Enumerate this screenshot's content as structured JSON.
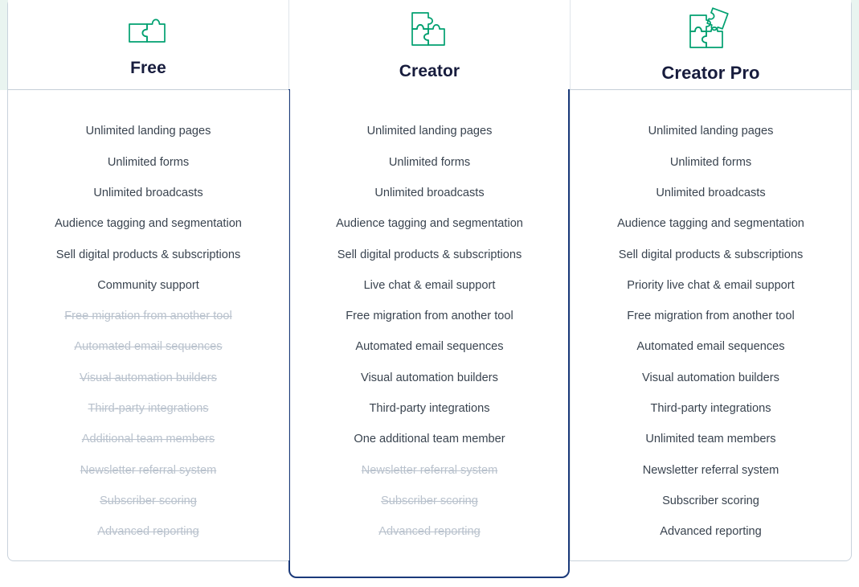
{
  "theme": {
    "accent_green": "#00a070",
    "heading_navy": "#171c3d",
    "body_text": "#39434f",
    "disabled_text": "#b9c2cd",
    "featured_border": "#1b3a7a",
    "divider": "#c5ced8",
    "mint_band": "#e9f4f0"
  },
  "plans": [
    {
      "name": "Free",
      "icon": "puzzle-2-piece-icon",
      "featured": false,
      "features": [
        {
          "label": "Unlimited landing pages",
          "included": true
        },
        {
          "label": "Unlimited forms",
          "included": true
        },
        {
          "label": "Unlimited broadcasts",
          "included": true
        },
        {
          "label": "Audience tagging and segmentation",
          "included": true
        },
        {
          "label": "Sell digital products & subscriptions",
          "included": true
        },
        {
          "label": "Community support",
          "included": true
        },
        {
          "label": "Free migration from another tool",
          "included": false
        },
        {
          "label": "Automated email sequences",
          "included": false
        },
        {
          "label": "Visual automation builders",
          "included": false
        },
        {
          "label": "Third-party integrations",
          "included": false
        },
        {
          "label": "Additional team members",
          "included": false
        },
        {
          "label": "Newsletter referral system",
          "included": false
        },
        {
          "label": "Subscriber scoring",
          "included": false
        },
        {
          "label": "Advanced reporting",
          "included": false
        }
      ]
    },
    {
      "name": "Creator",
      "icon": "puzzle-3-piece-icon",
      "featured": true,
      "features": [
        {
          "label": "Unlimited landing pages",
          "included": true
        },
        {
          "label": "Unlimited forms",
          "included": true
        },
        {
          "label": "Unlimited broadcasts",
          "included": true
        },
        {
          "label": "Audience tagging and segmentation",
          "included": true
        },
        {
          "label": "Sell digital products & subscriptions",
          "included": true
        },
        {
          "label": "Live chat & email support",
          "included": true
        },
        {
          "label": "Free migration from another tool",
          "included": true
        },
        {
          "label": "Automated email sequences",
          "included": true
        },
        {
          "label": "Visual automation builders",
          "included": true
        },
        {
          "label": "Third-party integrations",
          "included": true
        },
        {
          "label": "One additional team member",
          "included": true
        },
        {
          "label": "Newsletter referral system",
          "included": false
        },
        {
          "label": "Subscriber scoring",
          "included": false
        },
        {
          "label": "Advanced reporting",
          "included": false
        }
      ]
    },
    {
      "name": "Creator Pro",
      "icon": "puzzle-4-piece-icon",
      "featured": false,
      "features": [
        {
          "label": "Unlimited landing pages",
          "included": true
        },
        {
          "label": "Unlimited forms",
          "included": true
        },
        {
          "label": "Unlimited broadcasts",
          "included": true
        },
        {
          "label": "Audience tagging and segmentation",
          "included": true
        },
        {
          "label": "Sell digital products & subscriptions",
          "included": true
        },
        {
          "label": "Priority live chat & email support",
          "included": true
        },
        {
          "label": "Free migration from another tool",
          "included": true
        },
        {
          "label": "Automated email sequences",
          "included": true
        },
        {
          "label": "Visual automation builders",
          "included": true
        },
        {
          "label": "Third-party integrations",
          "included": true
        },
        {
          "label": "Unlimited team members",
          "included": true
        },
        {
          "label": "Newsletter referral system",
          "included": true
        },
        {
          "label": "Subscriber scoring",
          "included": true
        },
        {
          "label": "Advanced reporting",
          "included": true
        }
      ]
    }
  ]
}
